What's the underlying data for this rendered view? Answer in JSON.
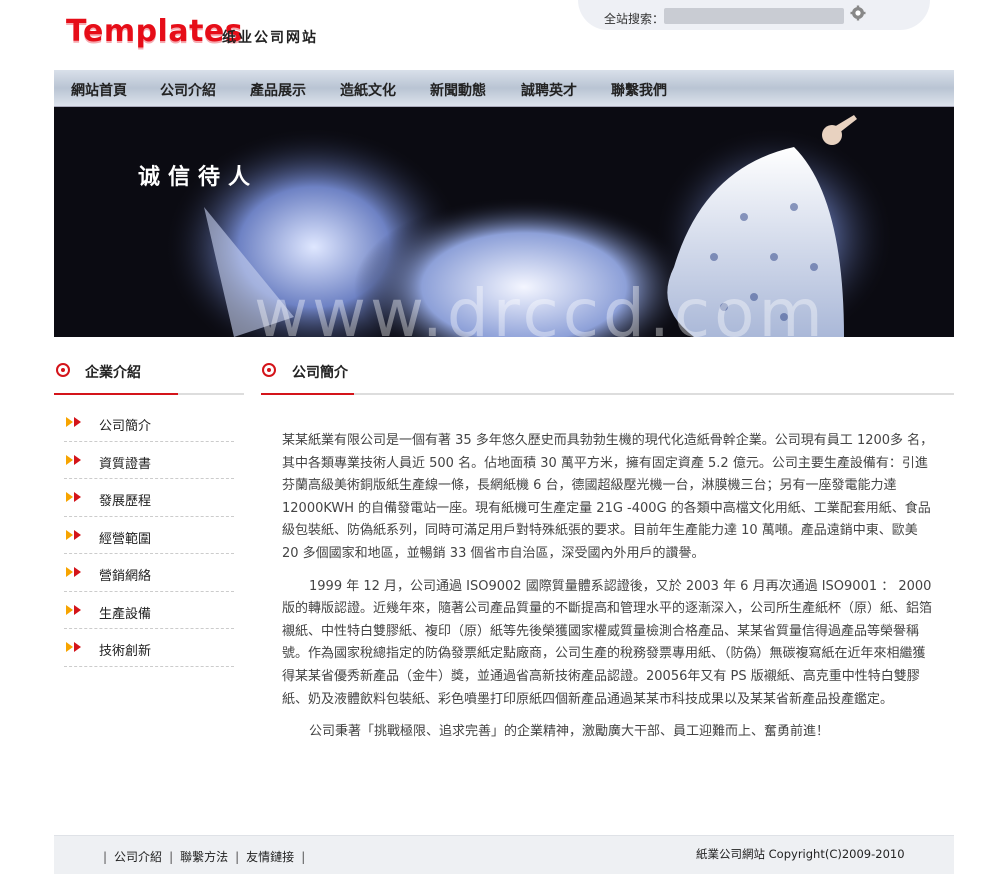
{
  "header": {
    "logo": "Templates",
    "subtitle": "纸业公司网站",
    "search_label": "全站搜索：",
    "search_placeholder": ""
  },
  "nav": {
    "items": [
      {
        "label": "網站首頁"
      },
      {
        "label": "公司介紹"
      },
      {
        "label": "產品展示"
      },
      {
        "label": "造紙文化"
      },
      {
        "label": "新聞動態"
      },
      {
        "label": "誠聘英才"
      },
      {
        "label": "聯繫我們"
      }
    ]
  },
  "banner": {
    "slogan": "诚信待人",
    "watermark": "www.drccd.com"
  },
  "sidebar": {
    "title": "企業介紹",
    "items": [
      {
        "label": "公司簡介"
      },
      {
        "label": "資質證書"
      },
      {
        "label": "發展歷程"
      },
      {
        "label": "經營範圍"
      },
      {
        "label": "營銷網絡"
      },
      {
        "label": "生產設備"
      },
      {
        "label": "技術創新"
      }
    ]
  },
  "main": {
    "title": "公司簡介",
    "paragraphs": [
      "某某紙業有限公司是一個有著 35 多年悠久歷史而具勃勃生機的現代化造紙骨幹企業。公司現有員工 1200多 名，其中各類專業技術人員近 500 名。佔地面積 30 萬平方米，擁有固定資產 5.2 億元。公司主要生產設備有：引進芬蘭高級美術銅版紙生產線一條，長網紙機 6 台，德國超級壓光機一台，淋膜機三台；另有一座發電能力達 12000KWH 的自備發電站一座。現有紙機可生產定量 21G -400G 的各類中高檔文化用紙、工業配套用紙、食品級包裝紙、防偽紙系列，同時可滿足用戶對特殊紙張的要求。目前年生產能力達 10 萬噸。產品遠銷中東、歐美 20 多個國家和地區，並暢銷 33 個省市自治區，深受國內外用戶的讚譽。",
      "1999 年 12 月，公司通過 ISO9002 國際質量體系認證後，又於 2003 年 6 月再次通過 ISO9001 ： 2000 版的轉版認證。近幾年來，隨著公司產品質量的不斷提高和管理水平的逐漸深入，公司所生產紙杯（原）紙、鋁箔襯紙、中性特白雙膠紙、複印（原）紙等先後榮獲國家權威質量檢測合格產品、某某省質量信得過產品等榮譽稱號。作為國家稅總指定的防偽發票紙定點廠商，公司生產的稅務發票專用紙、（防偽）無碳複寫紙在近年來相繼獲得某某省優秀新產品（金牛）獎，並通過省高新技術產品認證。20056年又有 PS 版襯紙、高克重中性特白雙膠紙、奶及液體飲料包裝紙、彩色噴墨打印原紙四個新產品通過某某市科技成果以及某某省新產品投產鑑定。",
      "公司秉著「挑戰極限、追求完善」的企業精神，激勵廣大干部、員工迎難而上、奮勇前進！"
    ]
  },
  "footer": {
    "links": [
      {
        "label": "公司介紹"
      },
      {
        "label": "聯繫方法"
      },
      {
        "label": "友情鏈接"
      }
    ],
    "separator": "|",
    "copyright": "紙業公司網站 Copyright(C)2009-2010"
  },
  "colors": {
    "accent": "#d4141a",
    "logo": "#e60d18",
    "nav_bg": "#c5cfdc",
    "arrow": "#f7a400"
  }
}
